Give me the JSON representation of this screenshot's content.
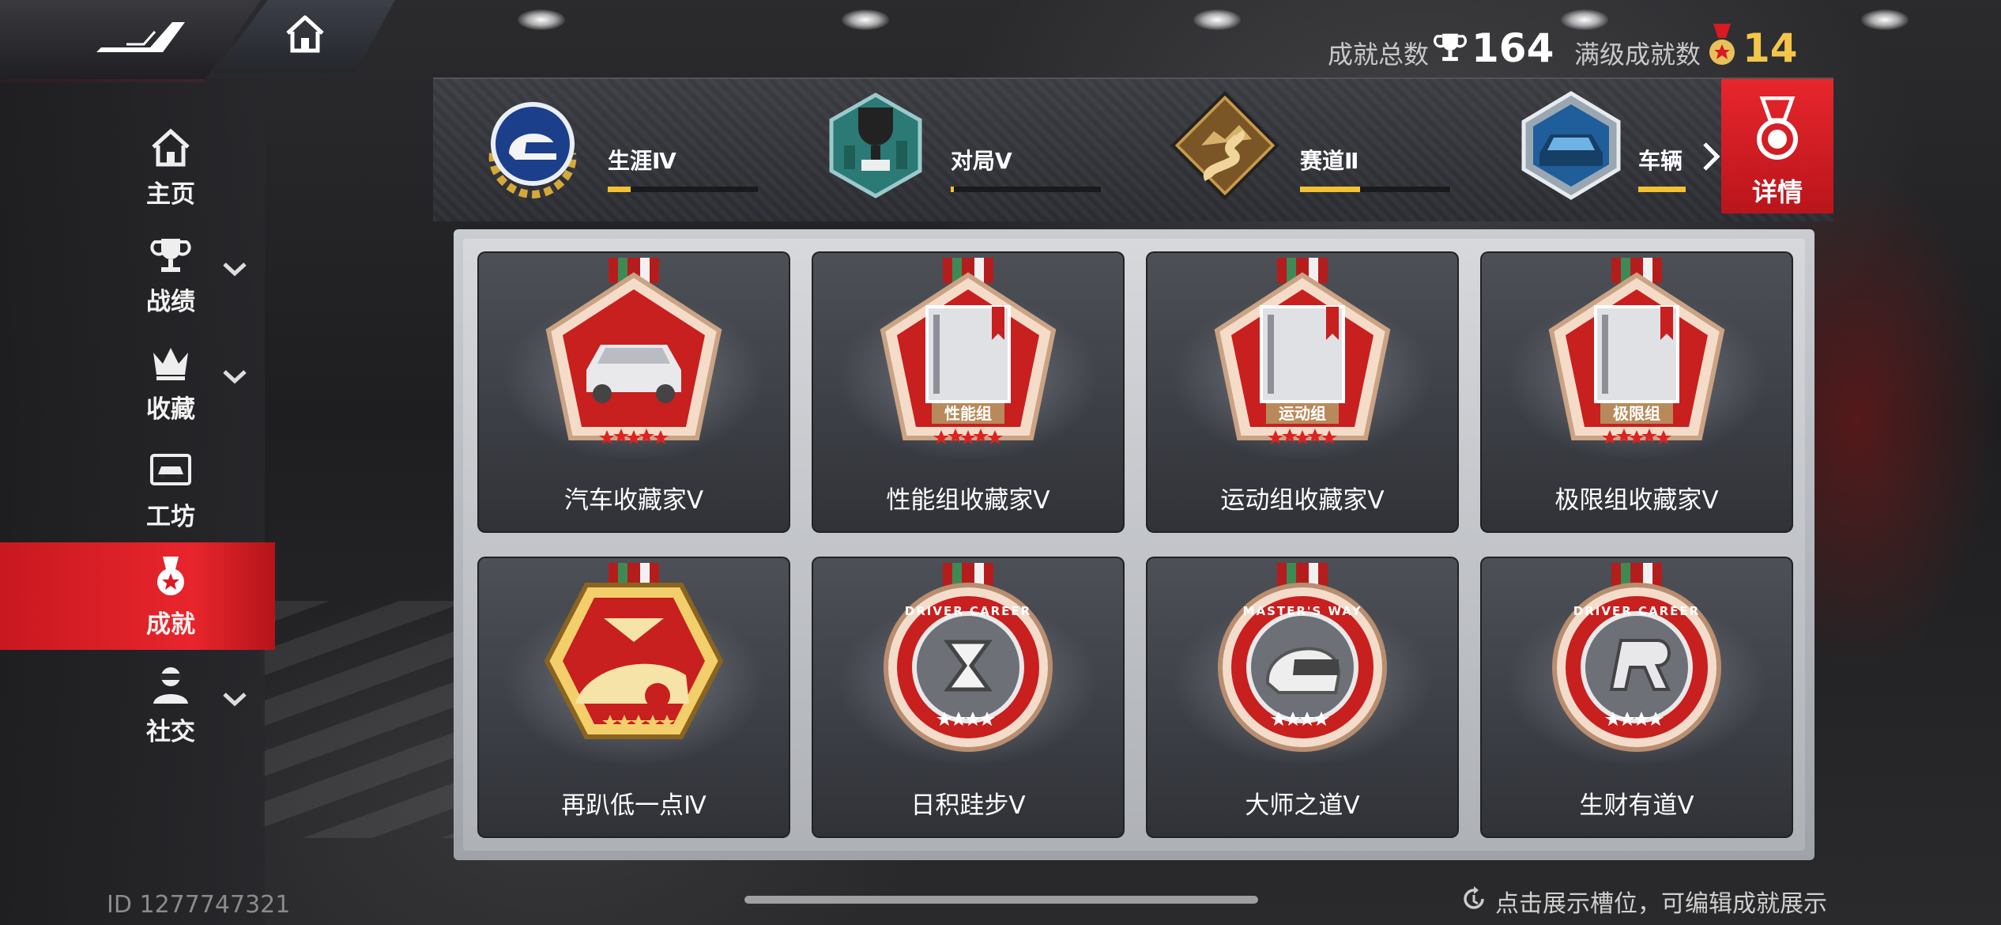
{
  "nav": {
    "sidebar": [
      {
        "label": "主页",
        "icon": "home-icon",
        "has_submenu": false,
        "active": false
      },
      {
        "label": "战绩",
        "icon": "trophy-icon",
        "has_submenu": true,
        "active": false
      },
      {
        "label": "收藏",
        "icon": "crown-icon",
        "has_submenu": true,
        "active": false
      },
      {
        "label": "工坊",
        "icon": "car-garage-icon",
        "has_submenu": false,
        "active": false
      },
      {
        "label": "成就",
        "icon": "medal-icon",
        "has_submenu": false,
        "active": true
      },
      {
        "label": "社交",
        "icon": "person-icon",
        "has_submenu": true,
        "active": false
      }
    ]
  },
  "stats": {
    "total_label": "成就总数",
    "total_value": "164",
    "maxed_label": "满级成就数",
    "maxed_value": "14"
  },
  "categories": [
    {
      "name": "生涯Ⅳ",
      "icon": "helmet-laurel-icon",
      "progress": 0.15
    },
    {
      "name": "对局Ⅴ",
      "icon": "trophy-city-icon",
      "progress": 0.02
    },
    {
      "name": "赛道Ⅱ",
      "icon": "winding-road-icon",
      "progress": 0.4
    },
    {
      "name": "车辆",
      "icon": "car-badge-icon",
      "progress": 0.3
    }
  ],
  "details_button": {
    "label": "详情",
    "icon": "medal-icon"
  },
  "achievements": [
    {
      "title": "汽车收藏家Ⅴ",
      "medal": "car-collector-medal",
      "tag": ""
    },
    {
      "title": "性能组收藏家Ⅴ",
      "medal": "book-medal",
      "tag": "性能组"
    },
    {
      "title": "运动组收藏家Ⅴ",
      "medal": "book-medal",
      "tag": "运动组"
    },
    {
      "title": "极限组收藏家Ⅴ",
      "medal": "book-medal",
      "tag": "极限组"
    },
    {
      "title": "再趴低一点Ⅳ",
      "medal": "lowered-car-medal",
      "tag": ""
    },
    {
      "title": "日积跬步Ⅴ",
      "medal": "hourglass-medal",
      "tag": "DRIVER CAREER"
    },
    {
      "title": "大师之道Ⅴ",
      "medal": "helmet-medal",
      "tag": "MASTER'S WAY"
    },
    {
      "title": "生财有道Ⅴ",
      "medal": "r-logo-medal",
      "tag": "DRIVER CAREER"
    }
  ],
  "footer": {
    "player_id": "ID 1277747321",
    "hint": "点击展示槽位，可编辑成就展示"
  },
  "colors": {
    "accent_red": "#e8252c",
    "gold": "#f3c233",
    "panel_silver": "#c9ccd1"
  }
}
